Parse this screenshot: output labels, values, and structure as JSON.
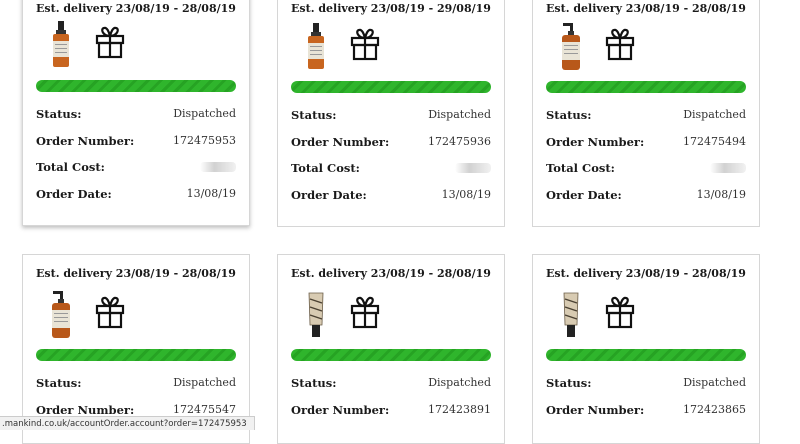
{
  "labels": {
    "status": "Status:",
    "order_number": "Order Number:",
    "total_cost": "Total Cost:",
    "order_date": "Order Date:"
  },
  "orders": [
    {
      "delivery": "Est. delivery 23/08/19 - 28/08/19",
      "product": "small-amber-bottle",
      "status": "Dispatched",
      "order_number": "172475953",
      "order_date": "13/08/19"
    },
    {
      "delivery": "Est. delivery 23/08/19 - 29/08/19",
      "product": "small-amber-bottle",
      "status": "Dispatched",
      "order_number": "172475936",
      "order_date": "13/08/19"
    },
    {
      "delivery": "Est. delivery 23/08/19 - 28/08/19",
      "product": "pump-bottle",
      "status": "Dispatched",
      "order_number": "172475494",
      "order_date": "13/08/19"
    },
    {
      "delivery": "Est. delivery 23/08/19 - 28/08/19",
      "product": "pump-bottle",
      "status": "Dispatched",
      "order_number": "172475547"
    },
    {
      "delivery": "Est. delivery 23/08/19 - 28/08/19",
      "product": "tube",
      "status": "Dispatched",
      "order_number": "172423891"
    },
    {
      "delivery": "Est. delivery 23/08/19 - 28/08/19",
      "product": "tube",
      "status": "Dispatched",
      "order_number": "172423865"
    }
  ],
  "status_bar_url": ".mankind.co.uk/accountOrder.account?order=172475953",
  "colors": {
    "progress": "#2fb52c",
    "border": "#d6d6d6"
  }
}
